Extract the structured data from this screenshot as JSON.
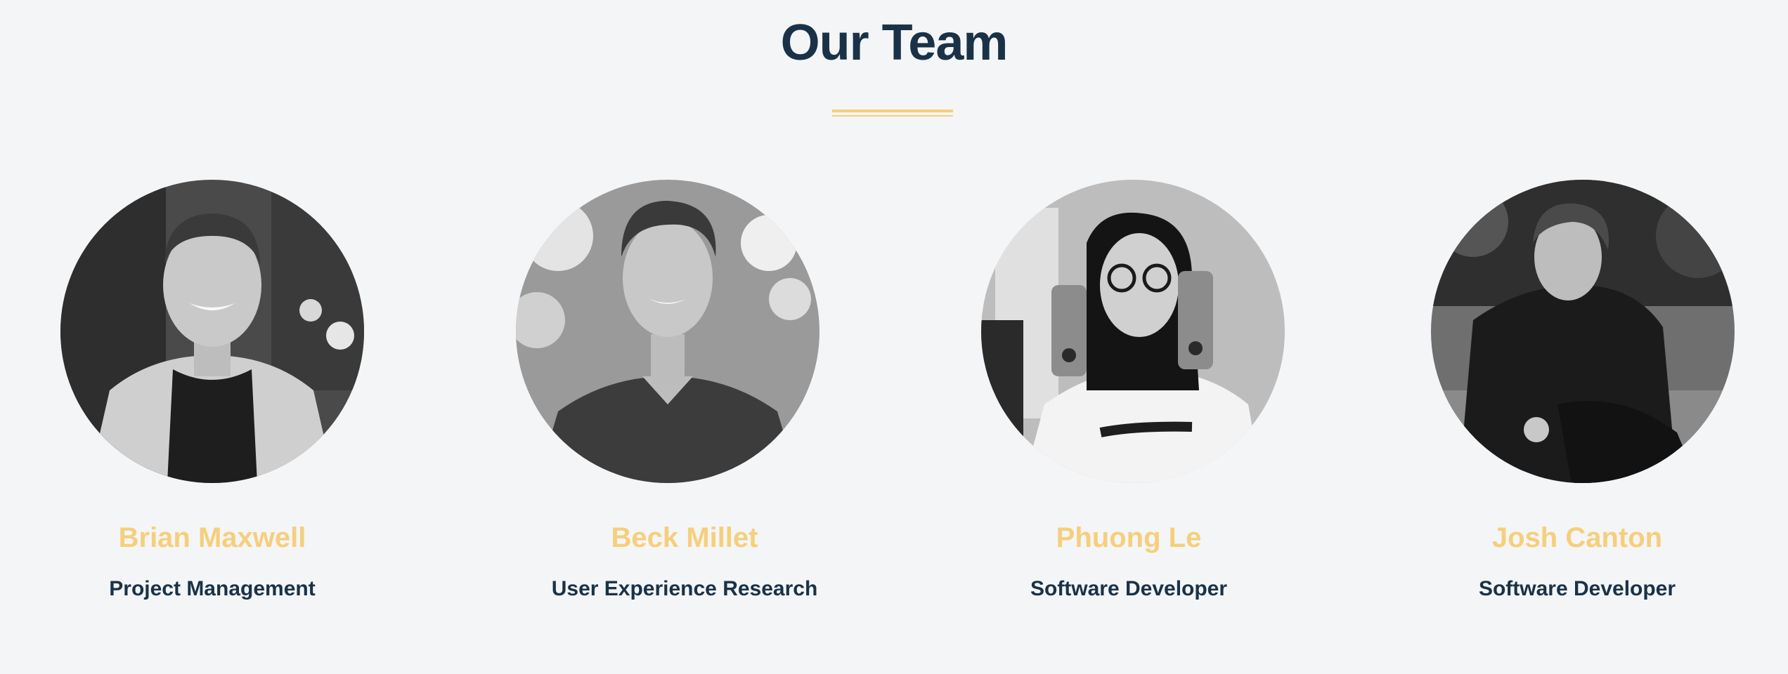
{
  "section": {
    "title": "Our Team"
  },
  "accent_color": "#f5cf7b",
  "heading_color": "#1a3247",
  "members": [
    {
      "name": "Brian Maxwell",
      "role": "Project Management",
      "photo_icon": "portrait-photo"
    },
    {
      "name": "Beck Millet",
      "role": "User Experience Research",
      "photo_icon": "portrait-photo"
    },
    {
      "name": "Phuong Le",
      "role": "Software Developer",
      "photo_icon": "portrait-photo"
    },
    {
      "name": "Josh Canton",
      "role": "Software Developer",
      "photo_icon": "portrait-photo"
    }
  ]
}
